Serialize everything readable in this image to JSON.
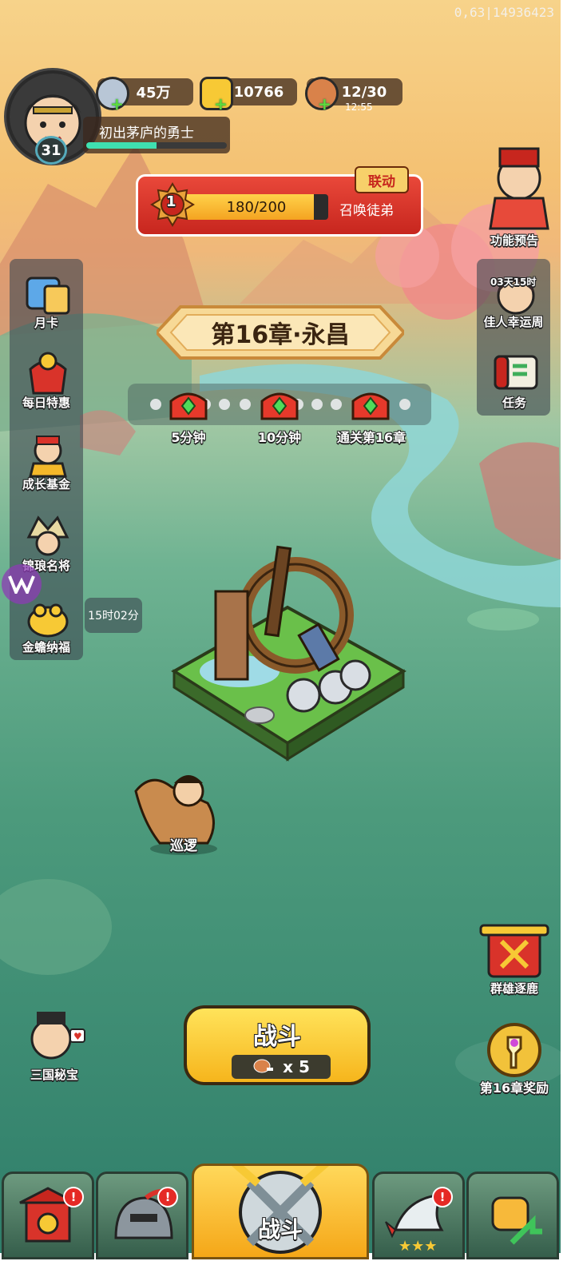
{
  "debug_text": "0,63|14936423",
  "player": {
    "level": "31",
    "title": "初出茅庐的勇士",
    "xp_fraction": 0.5
  },
  "resources": {
    "silver": "45万",
    "gold": "10766",
    "stamina": "12/30",
    "stamina_timer": "12:55"
  },
  "summon": {
    "rank": "1",
    "progress_text": "180/200",
    "progress_fraction": 0.9,
    "label": "召唤徒弟",
    "tag": "联动"
  },
  "right_top": {
    "preview_label": "功能预告",
    "event_timer": "03天15时",
    "event_label": "佳人幸运周",
    "quest_label": "任务"
  },
  "left_menu": [
    {
      "label": "月卡",
      "icon": "card-icon"
    },
    {
      "label": "每日特惠",
      "icon": "gift-bag-icon"
    },
    {
      "label": "成长基金",
      "icon": "fund-icon"
    },
    {
      "label": "锦琅名将",
      "icon": "general-icon"
    },
    {
      "label": "金蟾纳福",
      "icon": "toad-icon"
    }
  ],
  "left_timer": "15时02分",
  "chapter": {
    "title": "第16章·永昌",
    "rewards": [
      "5分钟",
      "10分钟",
      "通关第16章"
    ]
  },
  "patrol_label": "巡逻",
  "right_bottom": {
    "arena_label": "群雄逐鹿",
    "reward_label": "第16章奖励"
  },
  "treasure_label": "三国秘宝",
  "battle": {
    "label": "战斗",
    "cost": "x 5"
  },
  "bottom_nav": {
    "center_label": "战斗",
    "badge": "!"
  },
  "colors": {
    "accent_red": "#d3312a",
    "accent_gold": "#f6b51c",
    "xp_green": "#3fe0b0"
  }
}
